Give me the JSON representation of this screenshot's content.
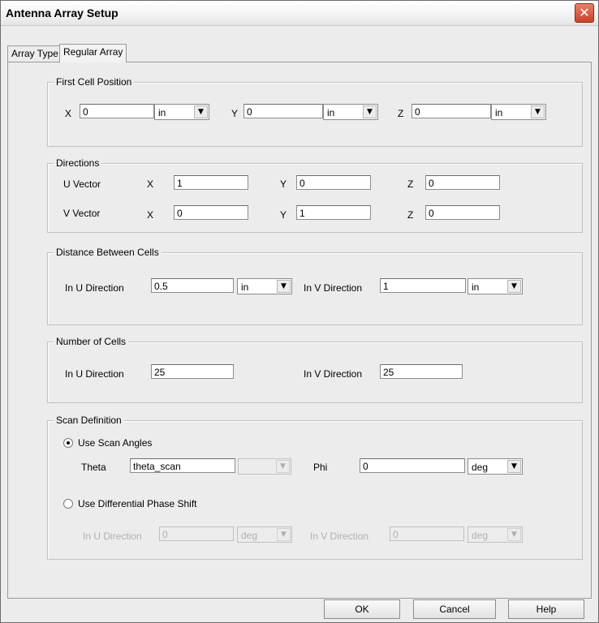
{
  "window": {
    "title": "Antenna Array Setup",
    "close_glyph": "✕"
  },
  "tabs": [
    {
      "label": "Array Type"
    },
    {
      "label": "Regular Array"
    }
  ],
  "first_cell": {
    "legend": "First Cell Position",
    "x_label": "X",
    "x_value": "0",
    "x_unit": "in",
    "y_label": "Y",
    "y_value": "0",
    "y_unit": "in",
    "z_label": "Z",
    "z_value": "0",
    "z_unit": "in"
  },
  "directions": {
    "legend": "Directions",
    "u_label": "U Vector",
    "v_label": "V Vector",
    "x_label": "X",
    "y_label": "Y",
    "z_label": "Z",
    "u": {
      "x": "1",
      "y": "0",
      "z": "0"
    },
    "v": {
      "x": "0",
      "y": "1",
      "z": "0"
    }
  },
  "distance": {
    "legend": "Distance Between Cells",
    "u_label": "In U Direction",
    "u_value": "0.5",
    "u_unit": "in",
    "v_label": "In V Direction",
    "v_value": "1",
    "v_unit": "in"
  },
  "cells": {
    "legend": "Number of Cells",
    "u_label": "In U Direction",
    "u_value": "25",
    "v_label": "In V Direction",
    "v_value": "25"
  },
  "scan": {
    "legend": "Scan Definition",
    "angles_label": "Use Scan Angles",
    "theta_label": "Theta",
    "theta_value": "theta_scan",
    "theta_unit": "",
    "phi_label": "Phi",
    "phi_value": "0",
    "phi_unit": "deg",
    "phase_label": "Use Differential Phase Shift",
    "u_label": "In U Direction",
    "u_value": "0",
    "u_unit": "deg",
    "v_label": "In V Direction",
    "v_value": "0",
    "v_unit": "deg"
  },
  "buttons": {
    "ok": "OK",
    "cancel": "Cancel",
    "help": "Help"
  },
  "icons": {
    "dropdown": "▼"
  }
}
